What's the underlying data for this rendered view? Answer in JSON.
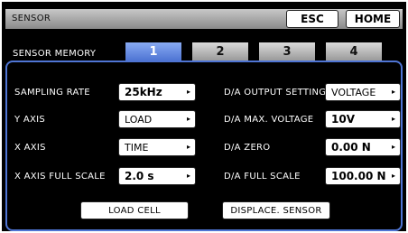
{
  "header": {
    "title": "SENSOR",
    "esc_label": "ESC",
    "home_label": "HOME"
  },
  "memory": {
    "label": "SENSOR MEMORY",
    "tabs": [
      {
        "label": "1",
        "active": true
      },
      {
        "label": "2",
        "active": false
      },
      {
        "label": "3",
        "active": false
      },
      {
        "label": "4",
        "active": false
      }
    ]
  },
  "left_settings": [
    {
      "label": "SAMPLING RATE",
      "value": "25kHz"
    },
    {
      "label": "Y AXIS",
      "value": "LOAD"
    },
    {
      "label": "X AXIS",
      "value": "TIME"
    },
    {
      "label": "X AXIS FULL SCALE",
      "value": "2.0 s"
    }
  ],
  "right_settings": [
    {
      "label": "D/A OUTPUT SETTING",
      "value": "VOLTAGE"
    },
    {
      "label": "D/A MAX. VOLTAGE",
      "value": "10V"
    },
    {
      "label": "D/A ZERO",
      "value": "0.00 N"
    },
    {
      "label": "D/A FULL SCALE",
      "value": "100.00 N"
    }
  ],
  "buttons": {
    "load_cell": "LOAD CELL",
    "displace_sensor": "DISPLACE. SENSOR"
  },
  "icons": {
    "dropdown_arrow": "▸"
  },
  "colors": {
    "accent": "#4f75d4",
    "background": "#000000"
  }
}
